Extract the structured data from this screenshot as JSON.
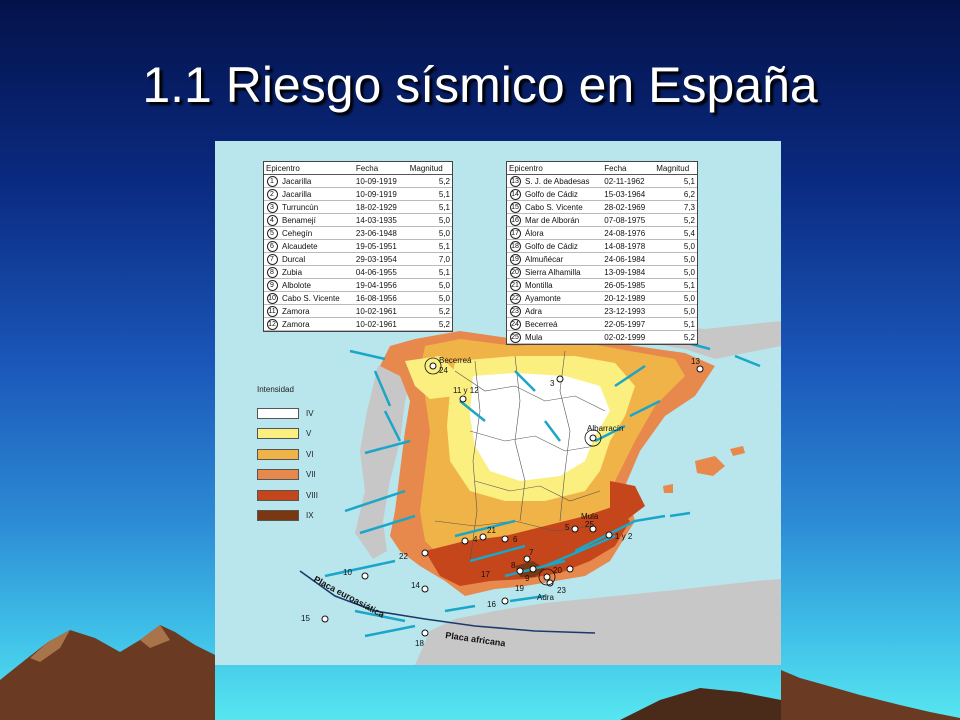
{
  "slide": {
    "title": "1.1 Riesgo sísmico en España"
  },
  "map": {
    "colors": {
      "sea": "#b9e6ec",
      "land_outside": "#c7c7c7",
      "IV": "#ffffff",
      "V": "#fbef80",
      "VI": "#f0b347",
      "VII": "#e7884d",
      "VIII": "#c4461a",
      "fault": "#1aa6c9"
    },
    "table_left": {
      "headers": [
        "Epicentro",
        "Fecha",
        "Magnitud"
      ],
      "rows": [
        {
          "n": "1",
          "place": "Jacarilla",
          "date": "10-09-1919",
          "mag": "5,2"
        },
        {
          "n": "2",
          "place": "Jacarilla",
          "date": "10-09-1919",
          "mag": "5,1"
        },
        {
          "n": "3",
          "place": "Turruncún",
          "date": "18-02-1929",
          "mag": "5,1"
        },
        {
          "n": "4",
          "place": "Benamejí",
          "date": "14-03-1935",
          "mag": "5,0"
        },
        {
          "n": "5",
          "place": "Cehegín",
          "date": "23-06-1948",
          "mag": "5,0"
        },
        {
          "n": "6",
          "place": "Alcaudete",
          "date": "19-05-1951",
          "mag": "5,1"
        },
        {
          "n": "7",
          "place": "Durcal",
          "date": "29-03-1954",
          "mag": "7,0"
        },
        {
          "n": "8",
          "place": "Zubia",
          "date": "04-06-1955",
          "mag": "5,1"
        },
        {
          "n": "9",
          "place": "Albolote",
          "date": "19-04-1956",
          "mag": "5,0"
        },
        {
          "n": "10",
          "place": "Cabo S. Vicente",
          "date": "16-08-1956",
          "mag": "5,0"
        },
        {
          "n": "11",
          "place": "Zamora",
          "date": "10-02-1961",
          "mag": "5,2"
        },
        {
          "n": "12",
          "place": "Zamora",
          "date": "10-02-1961",
          "mag": "5,2"
        }
      ]
    },
    "table_right": {
      "headers": [
        "Epicentro",
        "Fecha",
        "Magnitud"
      ],
      "rows": [
        {
          "n": "13",
          "place": "S. J. de Abadesas",
          "date": "02-11-1962",
          "mag": "5,1"
        },
        {
          "n": "14",
          "place": "Golfo de Cádiz",
          "date": "15-03-1964",
          "mag": "6,2"
        },
        {
          "n": "15",
          "place": "Cabo S. Vicente",
          "date": "28-02-1969",
          "mag": "7,3"
        },
        {
          "n": "16",
          "place": "Mar de Alborán",
          "date": "07-08-1975",
          "mag": "5,2"
        },
        {
          "n": "17",
          "place": "Álora",
          "date": "24-08-1976",
          "mag": "5,4"
        },
        {
          "n": "18",
          "place": "Golfo de Cádiz",
          "date": "14-08-1978",
          "mag": "5,0"
        },
        {
          "n": "19",
          "place": "Almuñécar",
          "date": "24-06-1984",
          "mag": "5,0"
        },
        {
          "n": "20",
          "place": "Sierra Alhamilla",
          "date": "13-09-1984",
          "mag": "5,0"
        },
        {
          "n": "21",
          "place": "Montilla",
          "date": "26-05-1985",
          "mag": "5,1"
        },
        {
          "n": "22",
          "place": "Ayamonte",
          "date": "20-12-1989",
          "mag": "5,0"
        },
        {
          "n": "23",
          "place": "Adra",
          "date": "23-12-1993",
          "mag": "5,0"
        },
        {
          "n": "24",
          "place": "Becerreá",
          "date": "22-05-1997",
          "mag": "5,1"
        },
        {
          "n": "25",
          "place": "Mula",
          "date": "02-02-1999",
          "mag": "5,2"
        }
      ]
    },
    "legend": {
      "title": "Intensidad",
      "items": [
        {
          "label": "IV",
          "color": "#ffffff"
        },
        {
          "label": "V",
          "color": "#fbef80"
        },
        {
          "label": "VI",
          "color": "#f0b347"
        },
        {
          "label": "VII",
          "color": "#e7884d"
        },
        {
          "label": "VIII",
          "color": "#c4461a"
        },
        {
          "label": "IX",
          "color": "#7a3812"
        }
      ]
    },
    "labels": {
      "becerrea": "Becerreá",
      "becerrea_n": "24",
      "n_11y12": "11 y 12",
      "n_3": "3",
      "n_13": "13",
      "albarracin": "Albarracín",
      "mula": "Mula",
      "n_25": "25",
      "n_5": "5",
      "n_1y2": "1 y 2",
      "n_21": "21",
      "n_4": "4",
      "n_6": "6",
      "n_22": "22",
      "n_10": "10",
      "n_14": "14",
      "n_15": "15",
      "n_17": "17",
      "n_19": "19",
      "n_16": "16",
      "n_18": "18",
      "n_20": "20",
      "n_23": "23",
      "n_7": "7",
      "n_8": "8",
      "n_9": "9",
      "adra": "Adra",
      "plate_euro": "Placa euroasiática",
      "plate_africa": "Placa africana"
    }
  }
}
